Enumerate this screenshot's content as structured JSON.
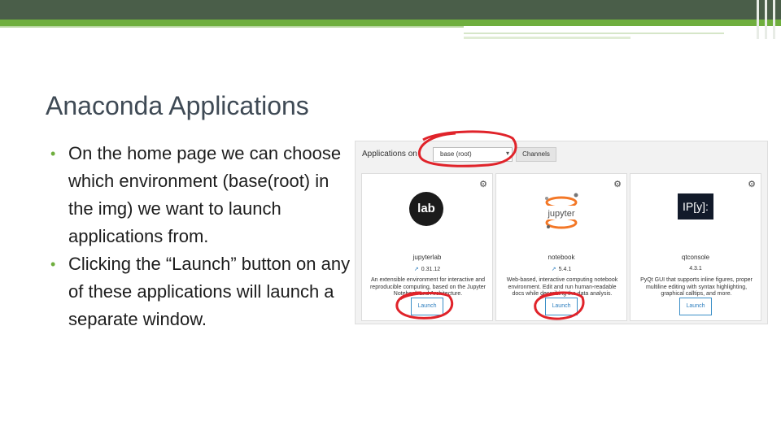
{
  "slide": {
    "title": "Anaconda Applications",
    "bullets": [
      "On the home page we can choose which environment (base(root) in the img) we want to launch applications from.",
      "Clicking the “Launch” button on any of these applications will launch a separate window."
    ]
  },
  "navigator": {
    "apps_on_label": "Applications on",
    "env_select_value": "base (root)",
    "channels_label": "Channels",
    "apps": [
      {
        "name": "jupyterlab",
        "version": "0.31.12",
        "logo_text": "lab",
        "description": "An extensible environment for interactive and reproducible computing, based on the Jupyter Notebook and Architecture.",
        "button_label": "Launch",
        "icon": "jupyterlab-logo"
      },
      {
        "name": "notebook",
        "version": "5.4.1",
        "logo_text": "jupyter",
        "description": "Web-based, interactive computing notebook environment. Edit and run human-readable docs while describing the data analysis.",
        "button_label": "Launch",
        "icon": "jupyter-logo"
      },
      {
        "name": "qtconsole",
        "version": "4.3.1",
        "logo_text": "IP[y]:",
        "description": "PyQt GUI that supports inline figures, proper multiline editing with syntax highlighting, graphical calltips, and more.",
        "button_label": "Launch",
        "icon": "ipython-logo"
      }
    ]
  },
  "colors": {
    "header_dark": "#4a5e49",
    "header_green": "#6fae3e",
    "annotation_red": "#e0232a",
    "launch_blue": "#2e7fbf"
  }
}
